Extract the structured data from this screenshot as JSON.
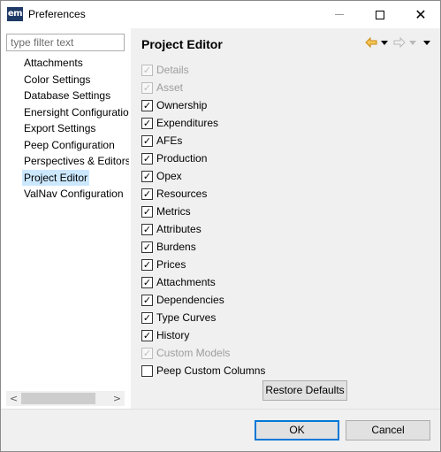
{
  "window": {
    "app_icon_text": "em",
    "title": "Preferences"
  },
  "left_pane": {
    "filter_placeholder": "type filter text",
    "tree_items": [
      {
        "label": "Attachments",
        "selected": false
      },
      {
        "label": "Color Settings",
        "selected": false
      },
      {
        "label": "Database Settings",
        "selected": false
      },
      {
        "label": "Enersight Configuratio",
        "selected": false
      },
      {
        "label": "Export Settings",
        "selected": false
      },
      {
        "label": "Peep Configuration",
        "selected": false
      },
      {
        "label": "Perspectives & Editors",
        "selected": false
      },
      {
        "label": "Project Editor",
        "selected": true
      },
      {
        "label": "ValNav Configuration",
        "selected": false
      }
    ],
    "scroll_left_glyph": "<",
    "scroll_right_glyph": ">"
  },
  "right_pane": {
    "title": "Project Editor",
    "options": [
      {
        "label": "Details",
        "checked": true,
        "enabled": false
      },
      {
        "label": "Asset",
        "checked": true,
        "enabled": false
      },
      {
        "label": "Ownership",
        "checked": true,
        "enabled": true
      },
      {
        "label": "Expenditures",
        "checked": true,
        "enabled": true
      },
      {
        "label": "AFEs",
        "checked": true,
        "enabled": true
      },
      {
        "label": "Production",
        "checked": true,
        "enabled": true
      },
      {
        "label": "Opex",
        "checked": true,
        "enabled": true
      },
      {
        "label": "Resources",
        "checked": true,
        "enabled": true
      },
      {
        "label": "Metrics",
        "checked": true,
        "enabled": true
      },
      {
        "label": "Attributes",
        "checked": true,
        "enabled": true
      },
      {
        "label": "Burdens",
        "checked": true,
        "enabled": true
      },
      {
        "label": "Prices",
        "checked": true,
        "enabled": true
      },
      {
        "label": "Attachments",
        "checked": true,
        "enabled": true
      },
      {
        "label": "Dependencies",
        "checked": true,
        "enabled": true
      },
      {
        "label": "Type Curves",
        "checked": true,
        "enabled": true
      },
      {
        "label": "History",
        "checked": true,
        "enabled": true
      },
      {
        "label": "Custom Models",
        "checked": true,
        "enabled": false
      },
      {
        "label": "Peep Custom Columns",
        "checked": false,
        "enabled": true
      }
    ],
    "restore_defaults_label": "Restore Defaults"
  },
  "footer": {
    "ok_label": "OK",
    "cancel_label": "Cancel"
  },
  "colors": {
    "accent": "#0078d7",
    "selection": "#cce8ff",
    "back_arrow": "#e8a21a"
  },
  "icons": [
    "app-icon",
    "minimize-icon",
    "maximize-icon",
    "close-icon",
    "back-arrow-icon",
    "forward-arrow-icon",
    "chevron-down-icon",
    "checkmark-icon"
  ]
}
